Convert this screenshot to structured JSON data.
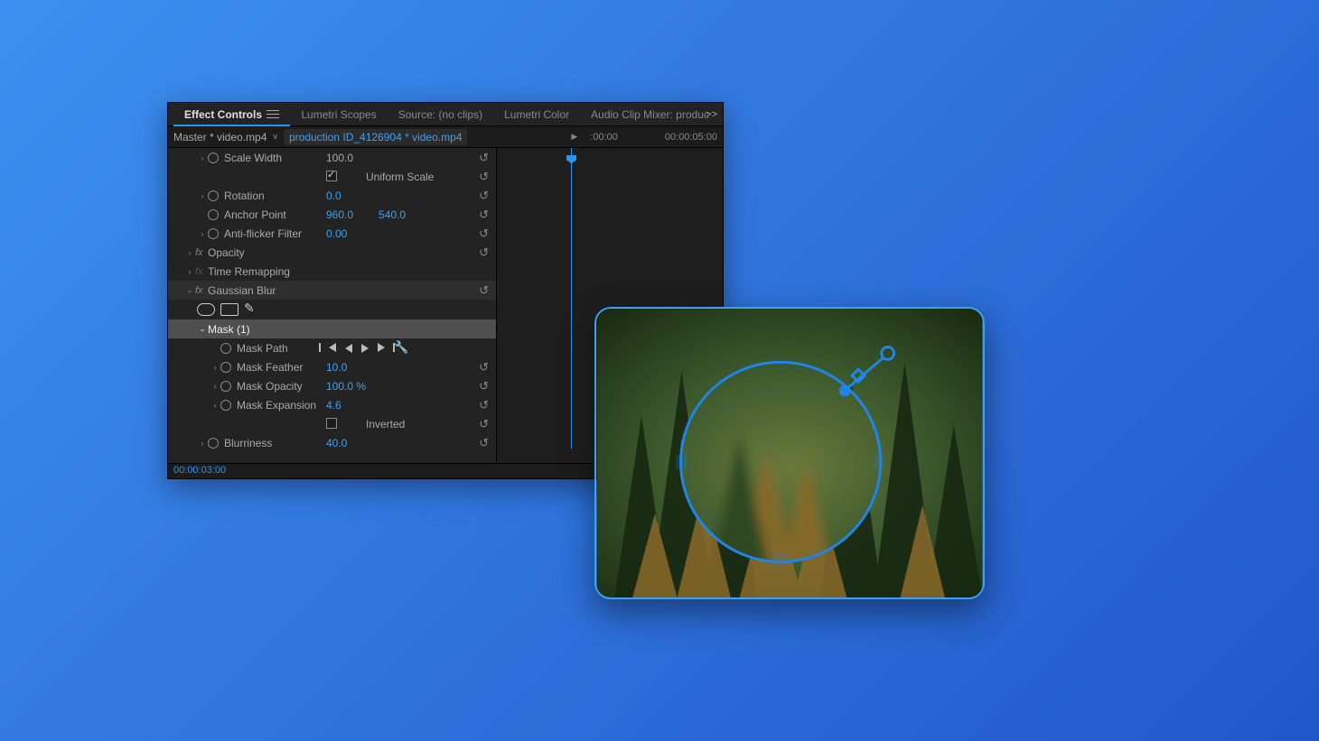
{
  "tabs": {
    "active": "Effect Controls",
    "t2": "Lumetri Scopes",
    "t3": "Source: (no clips)",
    "t4": "Lumetri Color",
    "t5": "Audio Clip Mixer: produc",
    "overflow": ">>"
  },
  "breadcrumb": {
    "master": "Master * video.mp4",
    "clip": "production ID_4126904 * video.mp4",
    "tc0": ":00:00",
    "tc5": "00:00:05:00"
  },
  "props": {
    "scaleWidth": {
      "label": "Scale Width",
      "value": "100.0"
    },
    "uniformScale": {
      "label": "Uniform Scale",
      "checked": true
    },
    "rotation": {
      "label": "Rotation",
      "value": "0.0"
    },
    "anchorPoint": {
      "label": "Anchor Point",
      "x": "960.0",
      "y": "540.0"
    },
    "antiFlicker": {
      "label": "Anti-flicker Filter",
      "value": "0.00"
    },
    "opacity": {
      "label": "Opacity"
    },
    "timeRemap": {
      "label": "Time Remapping"
    },
    "gaussian": {
      "label": "Gaussian Blur"
    },
    "mask": {
      "label": "Mask (1)"
    },
    "maskPath": {
      "label": "Mask Path"
    },
    "maskFeather": {
      "label": "Mask Feather",
      "value": "10.0"
    },
    "maskOpacity": {
      "label": "Mask Opacity",
      "value": "100.0 %"
    },
    "maskExpansion": {
      "label": "Mask Expansion",
      "value": "4.6"
    },
    "inverted": {
      "label": "Inverted",
      "checked": false
    },
    "blurriness": {
      "label": "Blurriness",
      "value": "40.0"
    }
  },
  "footer": {
    "time": "00:00:03:00"
  }
}
